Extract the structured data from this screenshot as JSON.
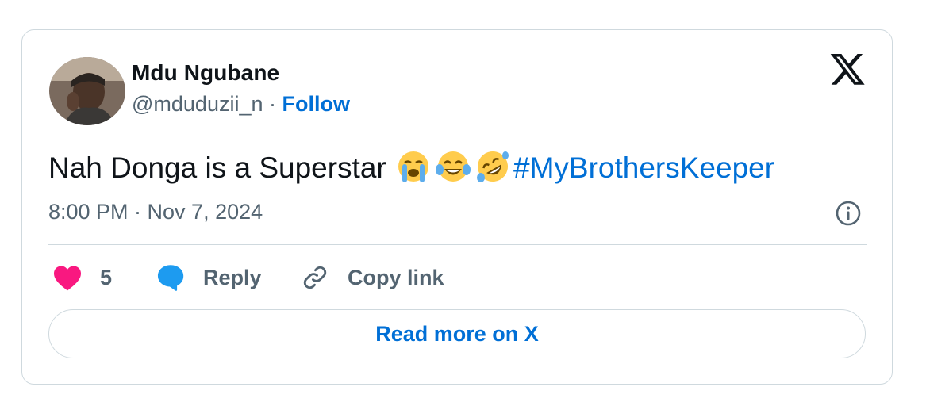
{
  "author": {
    "name": "Mdu Ngubane",
    "handle": "@mduduzii_n",
    "separator": " · ",
    "follow_label": "Follow"
  },
  "tweet": {
    "text": "Nah Donga is a Superstar ",
    "emojis": [
      "loudly-crying-face",
      "face-with-tears-of-joy",
      "rolling-on-the-floor-laughing"
    ],
    "hashtag": "#MyBrothersKeeper",
    "timestamp": "8:00 PM · Nov 7, 2024"
  },
  "actions": {
    "like_count": "5",
    "reply_label": "Reply",
    "copy_link_label": "Copy link",
    "read_more_label": "Read more on X"
  },
  "icons": {
    "logo": "x-logo-icon",
    "info": "info-icon",
    "like": "heart-icon",
    "reply": "speech-bubble-icon",
    "copy": "link-icon"
  },
  "colors": {
    "accent": "#006fd6",
    "heart": "#f91880",
    "reply_bubble": "#1d9bf0",
    "text_primary": "#0f1419",
    "text_secondary": "#536471",
    "border": "#cfd9de"
  }
}
